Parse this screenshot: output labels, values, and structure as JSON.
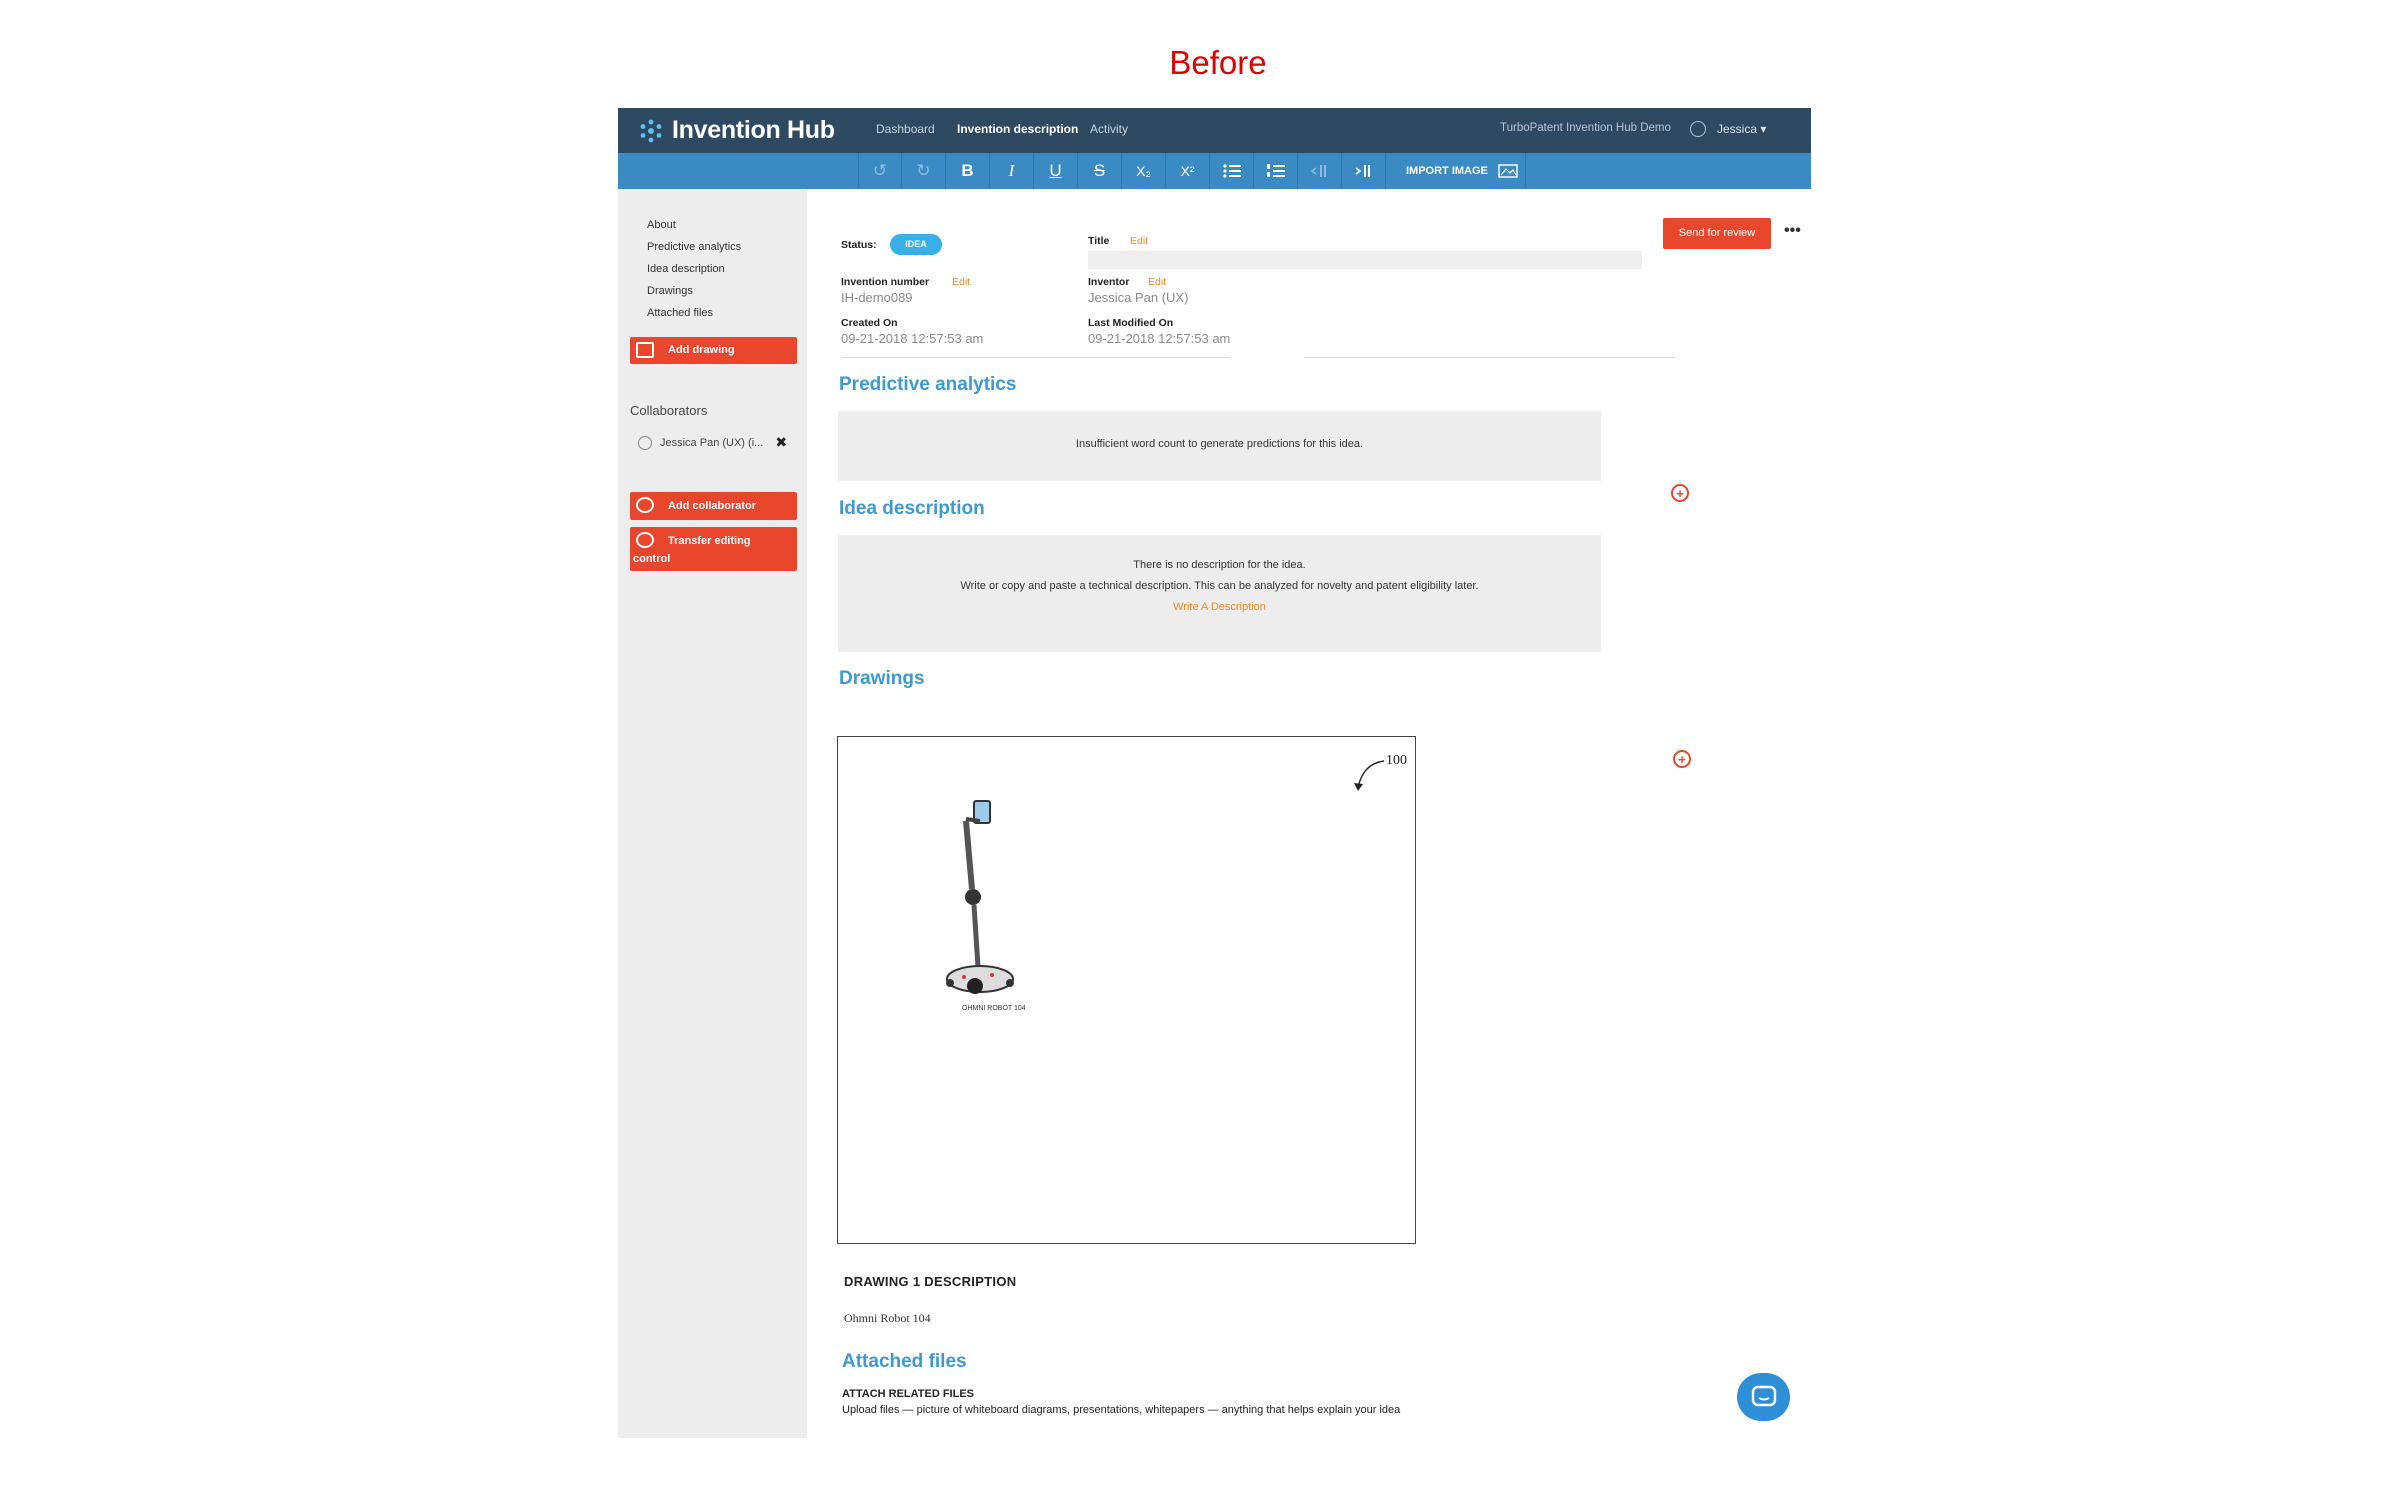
{
  "caption": "Before",
  "app": {
    "name": "Invention Hub",
    "nav": [
      "Dashboard",
      "Invention description",
      "Activity"
    ],
    "org": "TurboPatent Invention Hub Demo",
    "user": "Jessica ▾"
  },
  "toolbar": {
    "subscript": "X₂",
    "superscript": "X²",
    "import_image": "IMPORT IMAGE"
  },
  "sidebar": {
    "links": [
      "About",
      "Predictive analytics",
      "Idea description",
      "Drawings",
      "Attached files"
    ],
    "add_drawing": "Add drawing",
    "collaborators_title": "Collaborators",
    "collaborator": "Jessica Pan (UX)  (i...",
    "add_collaborator": "Add collaborator",
    "transfer_line1": "Transfer editing",
    "transfer_line2": "control"
  },
  "meta": {
    "status_label": "Status:",
    "status_value": "IDEA",
    "title_label": "Title",
    "edit": "Edit",
    "invention_number_label": "Invention number",
    "invention_number": "IH-demo089",
    "inventor_label": "Inventor",
    "inventor": "Jessica Pan (UX)",
    "created_label": "Created On",
    "created": "09-21-2018 12:57:53 am",
    "modified_label": "Last Modified On",
    "modified": "09-21-2018 12:57:53 am",
    "send_for_review": "Send for review",
    "more": "•••"
  },
  "predictive": {
    "heading": "Predictive analytics",
    "message": "Insufficient word count to generate predictions for this idea."
  },
  "idea": {
    "heading": "Idea description",
    "line1": "There is no description for the idea.",
    "line2": "Write or copy and paste a technical description. This can be analyzed for novelty and patent eligibility later.",
    "link": "Write A Description"
  },
  "drawings": {
    "heading": "Drawings",
    "ref_number": "100",
    "robot_caption": "OHMNI ROBOT 104",
    "desc_title": "DRAWING 1 DESCRIPTION",
    "desc_value": "Ohmni Robot 104"
  },
  "attached": {
    "heading": "Attached files",
    "sub": "ATTACH RELATED FILES",
    "help": "Upload files — picture of whiteboard diagrams, presentations, whitepapers — anything that helps explain your idea"
  },
  "colors": {
    "navbar": "#2e4a63",
    "toolbar": "#3a8ac4",
    "accent_red": "#e8472d",
    "heading_blue": "#3d9ad1",
    "edit_orange": "#f08a24"
  }
}
